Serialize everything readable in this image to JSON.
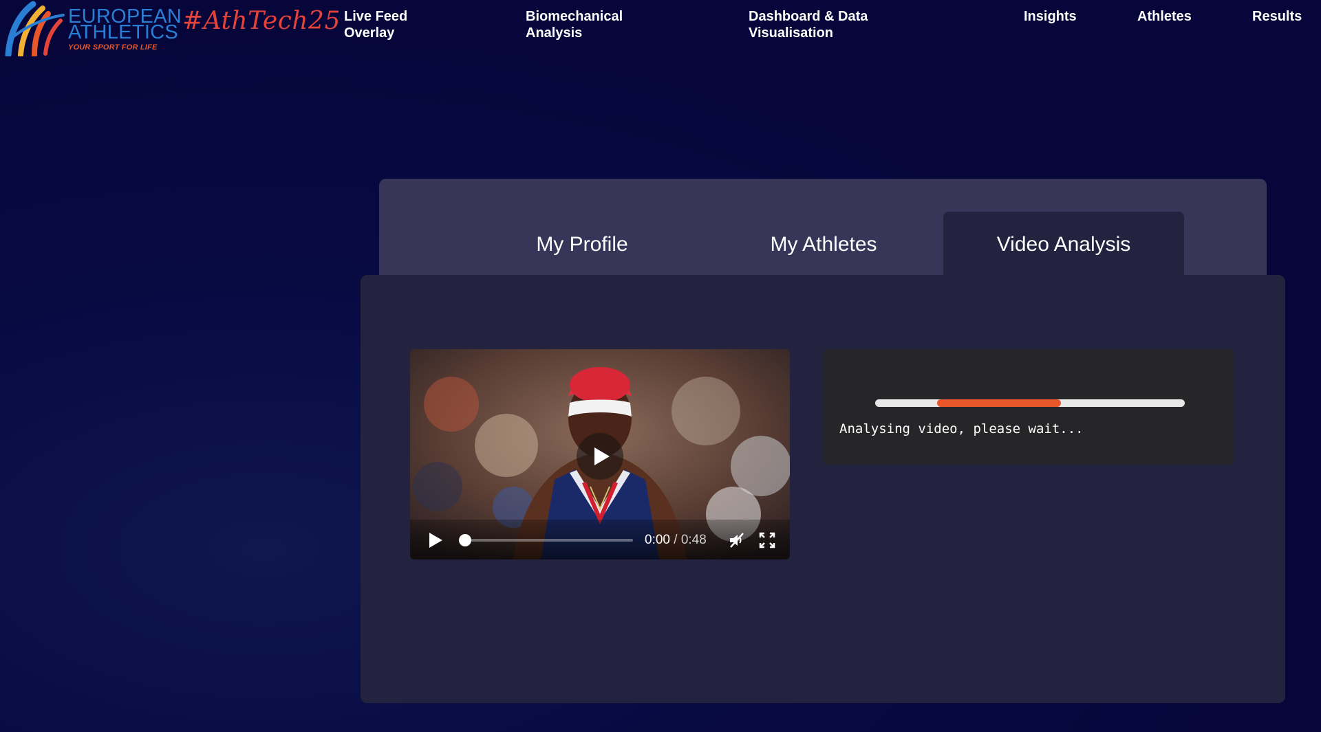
{
  "header": {
    "logo": {
      "line1": "EUROPEAN",
      "line2": "ATHLETICS",
      "tagline": "YOUR SPORT FOR LIFE"
    },
    "hashtag": "#AthTech25",
    "nav": [
      {
        "label": "Live Feed\nOverlay"
      },
      {
        "label": "Biomechanical\nAnalysis"
      },
      {
        "label": "Dashboard & Data\nVisualisation"
      },
      {
        "label": "Insights"
      },
      {
        "label": "Athletes"
      },
      {
        "label": "Results"
      }
    ]
  },
  "tabs": [
    {
      "label": "My Profile",
      "active": false
    },
    {
      "label": "My Athletes",
      "active": false
    },
    {
      "label": "Video Analysis",
      "active": true
    }
  ],
  "video": {
    "current_time": "0:00",
    "separator": " / ",
    "duration": "0:48",
    "played_fraction": 0,
    "muted": true
  },
  "analysis": {
    "progress_start_fraction": 0.2,
    "progress_end_fraction": 0.6,
    "status": "Analysing video, please wait..."
  },
  "colors": {
    "accent": "#e8562a",
    "brand_blue": "#2a7fd4",
    "hashtag_red": "#e3433a",
    "page_bg": "#06063a",
    "panel": "#232340",
    "tab_bar": "#373659"
  }
}
